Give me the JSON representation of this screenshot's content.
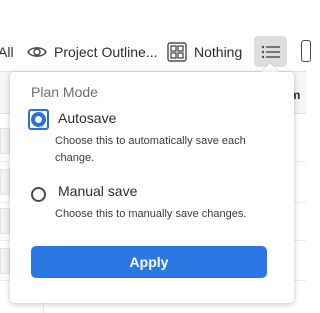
{
  "toolbar": {
    "all_label": "All",
    "outline_label": "Project Outline...",
    "outline_icon": "eye-icon",
    "nothing_label": "Nothing",
    "nothing_icon": "group-by-grid-icon",
    "menu_icon": "list-menu-icon"
  },
  "grid": {
    "header_label": "am"
  },
  "plan_mode": {
    "heading": "Plan Mode",
    "options": [
      {
        "label": "Autosave",
        "description": "Choose this to automatically save each change.",
        "selected": true
      },
      {
        "label": "Manual save",
        "description": "Choose this to manually save changes.",
        "selected": false
      }
    ],
    "apply_label": "Apply"
  },
  "colors": {
    "accent": "#2b78e4",
    "toolbar_active_bg": "#dedede"
  }
}
